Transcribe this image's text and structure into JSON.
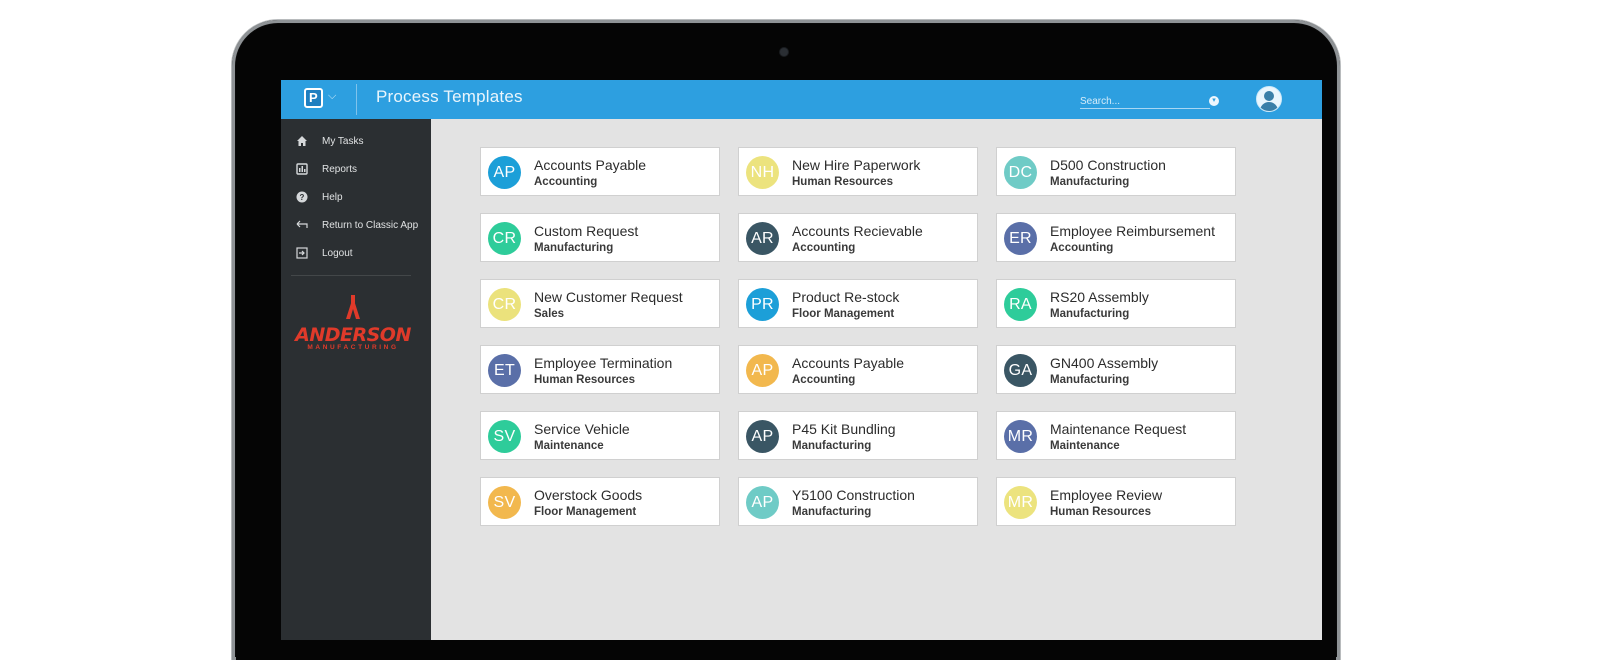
{
  "header": {
    "title": "Process Templates",
    "search_placeholder": "Search...",
    "colors": {
      "topbar": "#2d9fe0",
      "sidebar": "#2b2f32"
    }
  },
  "sidebar": {
    "items": [
      {
        "label": "My Tasks",
        "icon": "home-icon"
      },
      {
        "label": "Reports",
        "icon": "bar-chart-icon"
      },
      {
        "label": "Help",
        "icon": "help-circle-icon"
      },
      {
        "label": "Return to Classic App",
        "icon": "return-arrow-icon"
      },
      {
        "label": "Logout",
        "icon": "logout-icon"
      }
    ],
    "brand": {
      "name": "ANDERSON",
      "sub": "MANUFACTURING",
      "color": "#e03a2a"
    }
  },
  "templates": [
    {
      "initials": "AP",
      "name": "Accounts Payable",
      "dept": "Accounting",
      "color": "#1c9fd8"
    },
    {
      "initials": "NH",
      "name": "New Hire Paperwork",
      "dept": "Human Resources",
      "color": "#ece37e"
    },
    {
      "initials": "DC",
      "name": "D500 Construction",
      "dept": "Manufacturing",
      "color": "#6fcbc6"
    },
    {
      "initials": "CR",
      "name": "Custom Request",
      "dept": "Manufacturing",
      "color": "#2ecc9a"
    },
    {
      "initials": "AR",
      "name": "Accounts Recievable",
      "dept": "Accounting",
      "color": "#3a5664"
    },
    {
      "initials": "ER",
      "name": "Employee Reimbursement",
      "dept": "Accounting",
      "color": "#5a6fa8"
    },
    {
      "initials": "CR",
      "name": "New Customer Request",
      "dept": "Sales",
      "color": "#ebe27c"
    },
    {
      "initials": "PR",
      "name": "Product Re-stock",
      "dept": "Floor Management",
      "color": "#1c9fd8"
    },
    {
      "initials": "RA",
      "name": "RS20 Assembly",
      "dept": "Manufacturing",
      "color": "#2ecc9a"
    },
    {
      "initials": "ET",
      "name": "Employee Termination",
      "dept": "Human Resources",
      "color": "#5a6fa8"
    },
    {
      "initials": "AP",
      "name": "Accounts Payable",
      "dept": "Accounting",
      "color": "#f2b84e"
    },
    {
      "initials": "GA",
      "name": "GN400 Assembly",
      "dept": "Manufacturing",
      "color": "#3a5664"
    },
    {
      "initials": "SV",
      "name": "Service Vehicle",
      "dept": "Maintenance",
      "color": "#2ecc9a"
    },
    {
      "initials": "AP",
      "name": "P45 Kit Bundling",
      "dept": "Manufacturing",
      "color": "#3a5664"
    },
    {
      "initials": "MR",
      "name": "Maintenance Request",
      "dept": "Maintenance",
      "color": "#5a6fa8"
    },
    {
      "initials": "SV",
      "name": "Overstock Goods",
      "dept": "Floor Management",
      "color": "#f2b84e"
    },
    {
      "initials": "AP",
      "name": "Y5100 Construction",
      "dept": "Manufacturing",
      "color": "#6fcbc6"
    },
    {
      "initials": "MR",
      "name": "Employee Review",
      "dept": "Human Resources",
      "color": "#ece37e"
    }
  ]
}
